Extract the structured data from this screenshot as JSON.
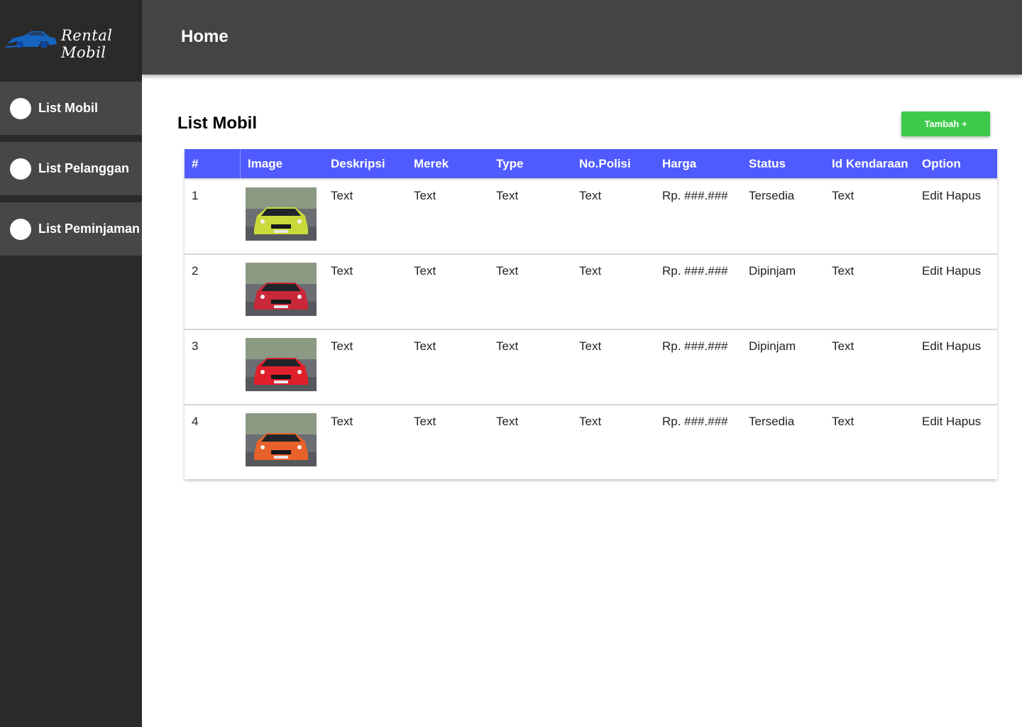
{
  "brand": {
    "name": "Rental Mobil",
    "icon": "car-logo-icon",
    "icon_color": "#1565c0"
  },
  "sidebar": {
    "items": [
      {
        "label": "List Mobil"
      },
      {
        "label": "List Pelanggan"
      },
      {
        "label": "List Peminjaman"
      }
    ]
  },
  "header": {
    "title": "Home"
  },
  "main": {
    "title": "List Mobil",
    "add_button": "Tambah +"
  },
  "table": {
    "columns": [
      "#",
      "Image",
      "Deskripsi",
      "Merek",
      "Type",
      "No.Polisi",
      "Harga",
      "Status",
      "Id Kendaraan",
      "Option"
    ],
    "rows": [
      {
        "no": "1",
        "car_color": "#c9d93a",
        "deskripsi": "Text",
        "merek": "Text",
        "type": "Text",
        "no_polisi": "Text",
        "harga": "Rp. ###.###",
        "status": "Tersedia",
        "id_kendaraan": "Text",
        "edit": "Edit",
        "hapus": "Hapus"
      },
      {
        "no": "2",
        "car_color": "#c8283a",
        "deskripsi": "Text",
        "merek": "Text",
        "type": "Text",
        "no_polisi": "Text",
        "harga": "Rp. ###.###",
        "status": "Dipinjam",
        "id_kendaraan": "Text",
        "edit": "Edit",
        "hapus": "Hapus"
      },
      {
        "no": "3",
        "car_color": "#e0202a",
        "deskripsi": "Text",
        "merek": "Text",
        "type": "Text",
        "no_polisi": "Text",
        "harga": "Rp. ###.###",
        "status": "Dipinjam",
        "id_kendaraan": "Text",
        "edit": "Edit",
        "hapus": "Hapus"
      },
      {
        "no": "4",
        "car_color": "#e8612a",
        "deskripsi": "Text",
        "merek": "Text",
        "type": "Text",
        "no_polisi": "Text",
        "harga": "Rp. ###.###",
        "status": "Tersedia",
        "id_kendaraan": "Text",
        "edit": "Edit",
        "hapus": "Hapus"
      }
    ]
  },
  "colors": {
    "header_bg": "#4f5bff",
    "add_button_bg": "#3ec94a",
    "sidebar_bg": "#2a2a2a",
    "topbar_bg": "#444444"
  }
}
